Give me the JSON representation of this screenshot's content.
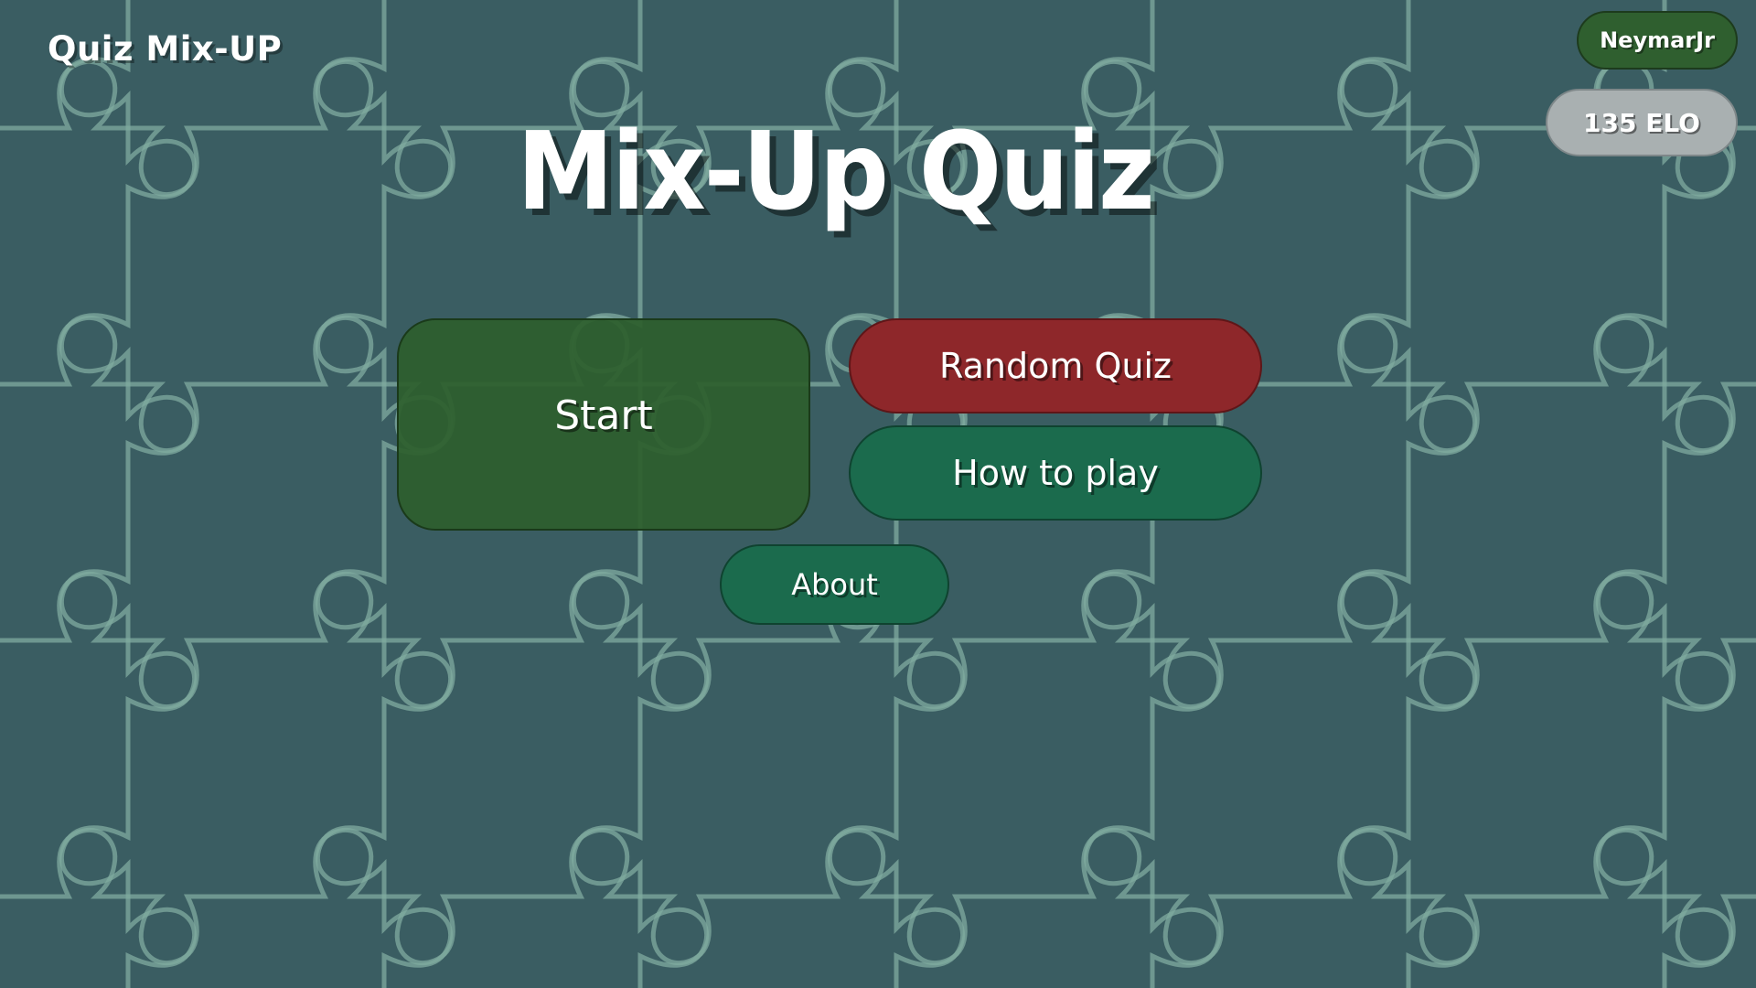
{
  "header": {
    "brand": "Quiz Mix-UP"
  },
  "user": {
    "name": "NeymarJr",
    "elo": "135 ELO"
  },
  "title": "Mix-Up Quiz",
  "menu": {
    "start_label": "Start",
    "random_label": "Random Quiz",
    "howto_label": "How to play",
    "about_label": "About"
  },
  "colors": {
    "background": "#3a5d62",
    "puzzle_lines": "#7fab9f",
    "start": "#2d5f2d",
    "random": "#8e272a",
    "howto": "#1b6b4d",
    "about": "#1b6b4d",
    "user_pill": "#2f5f2f",
    "elo_pill": "#a9b0b1"
  },
  "background_pattern": "puzzle-pieces"
}
